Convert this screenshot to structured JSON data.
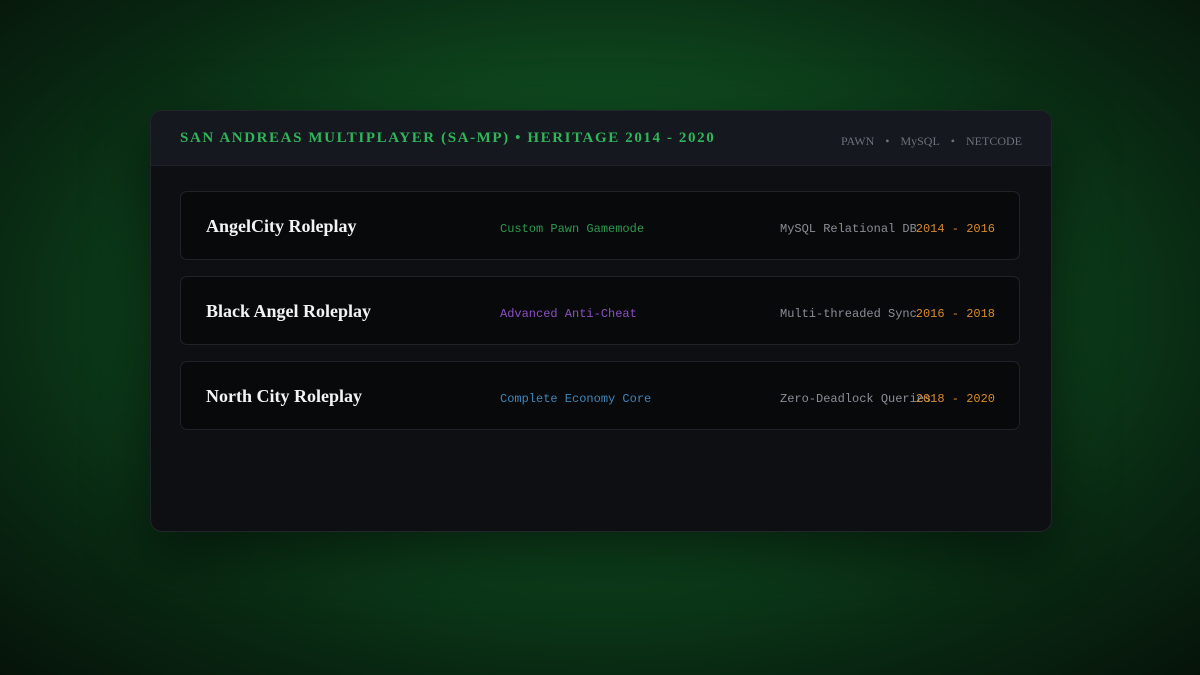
{
  "header": {
    "title": "SAN ANDREAS MULTIPLAYER (SA-MP) • HERITAGE 2014 - 2020",
    "tags": [
      "PAWN",
      "MySQL",
      "NETCODE"
    ],
    "separator": "•"
  },
  "servers": [
    {
      "name": "AngelCity Roleplay",
      "feature": "Custom Pawn Gamemode",
      "detail": "MySQL Relational DB",
      "years": "2014 - 2016"
    },
    {
      "name": "Black Angel Roleplay",
      "feature": "Advanced Anti-Cheat",
      "detail": "Multi-threaded Sync",
      "years": "2016 - 2018"
    },
    {
      "name": "North City Roleplay",
      "feature": "Complete Economy Core",
      "detail": "Zero-Deadlock Queries",
      "years": "2018 - 2020"
    }
  ],
  "colors": {
    "accent_green": "#2fb55a",
    "feature_green": "#2c9a4f",
    "feature_purple": "#8a4fc1",
    "feature_blue": "#3f85b8",
    "years_orange": "#d98a2b"
  }
}
